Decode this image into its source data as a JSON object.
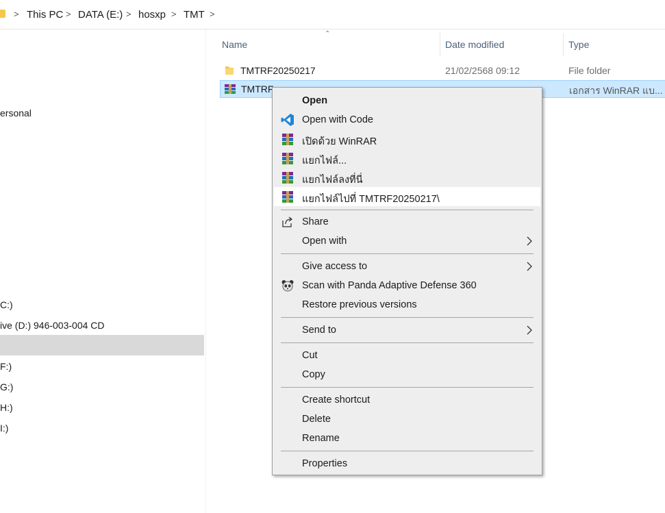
{
  "breadcrumb": {
    "items": [
      "This PC",
      "DATA (E:)",
      "hosxp",
      "TMT"
    ]
  },
  "nav": {
    "items": [
      "ersonal",
      "C:)",
      "ive (D:) 946-003-004 CD",
      "F:)",
      "G:)",
      "H:)",
      "I:)"
    ]
  },
  "columns": {
    "name": "Name",
    "date": "Date modified",
    "type": "Type"
  },
  "files": [
    {
      "name": "TMTRF20250217",
      "date": "21/02/2568 09:12",
      "type": "File folder",
      "icon": "folder-icon"
    },
    {
      "name": "TMTRF",
      "date": "",
      "type": "เอกสาร WinRAR แบ...",
      "icon": "winrar-icon"
    }
  ],
  "context_menu": {
    "items": [
      {
        "label": "Open",
        "bold": true,
        "icon": ""
      },
      {
        "label": "Open with Code",
        "icon": "vscode-icon"
      },
      {
        "label": "เปิดด้วย WinRAR",
        "icon": "winrar-icon"
      },
      {
        "label": "แยกไฟล์...",
        "icon": "winrar-icon"
      },
      {
        "label": "แยกไฟล์ลงที่นี่",
        "icon": "winrar-icon"
      },
      {
        "label": "แยกไฟล์ไปที่ TMTRF20250217\\",
        "icon": "winrar-icon"
      },
      {
        "label": "Share",
        "icon": "share-icon"
      },
      {
        "label": "Open with",
        "submenu": true
      },
      {
        "label": "Give access to",
        "submenu": true
      },
      {
        "label": "Scan with Panda Adaptive Defense 360",
        "icon": "panda-icon"
      },
      {
        "label": "Restore previous versions"
      },
      {
        "label": "Send to",
        "submenu": true
      },
      {
        "label": "Cut"
      },
      {
        "label": "Copy"
      },
      {
        "label": "Create shortcut"
      },
      {
        "label": "Delete"
      },
      {
        "label": "Rename"
      },
      {
        "label": "Properties"
      }
    ]
  },
  "colors": {
    "selection_bg": "#cce8ff",
    "selection_border": "#99d1ff",
    "menu_bg": "#eeeeee",
    "folder": "#f2c94c",
    "vscode_blue": "#1f86d8"
  }
}
